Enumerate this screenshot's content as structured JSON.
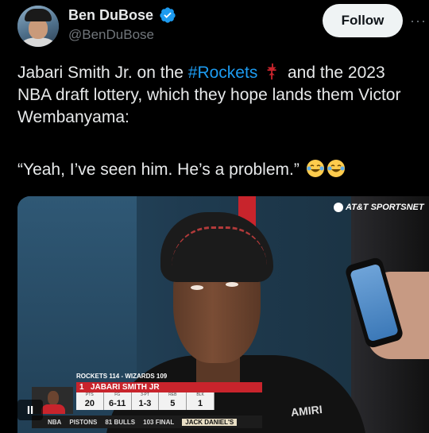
{
  "author": {
    "name": "Ben DuBose",
    "handle": "@BenDuBose",
    "verified_icon": "verified-badge-icon",
    "verified_color": "#1d9bf0"
  },
  "follow_label": "Follow",
  "more_icon": "more-horizontal-icon",
  "tweet": {
    "text_before": "Jabari Smith Jr. on the ",
    "hashtag": "#Rockets",
    "rockets_icon": "rockets-logo-icon",
    "text_after": " and the 2023 NBA draft lottery, which they hope lands them Victor Wembanyama:",
    "quote": "“Yeah, I’ve seen him. He’s a problem.”",
    "emoji": "tears-of-joy-emoji",
    "hashtag_color": "#1d9bf0"
  },
  "media": {
    "network_logo": "AT&T SPORTSNET",
    "scorebug": {
      "score_line": "ROCKETS 114 - WIZARDS 109",
      "player_number": "1",
      "player_name": "JABARI SMITH JR",
      "stats": [
        {
          "label": "PTS",
          "value": "20"
        },
        {
          "label": "FG",
          "value": "6-11"
        },
        {
          "label": "3-PT",
          "value": "1-3"
        },
        {
          "label": "REB",
          "value": "5"
        },
        {
          "label": "BLK",
          "value": "1"
        }
      ],
      "ticker": [
        "NBA",
        "PISTONS",
        "81 BULLS",
        "103 FINAL",
        "JACK DANIEL'S"
      ]
    },
    "pause_label": "II",
    "background_text": "AMIRI"
  }
}
